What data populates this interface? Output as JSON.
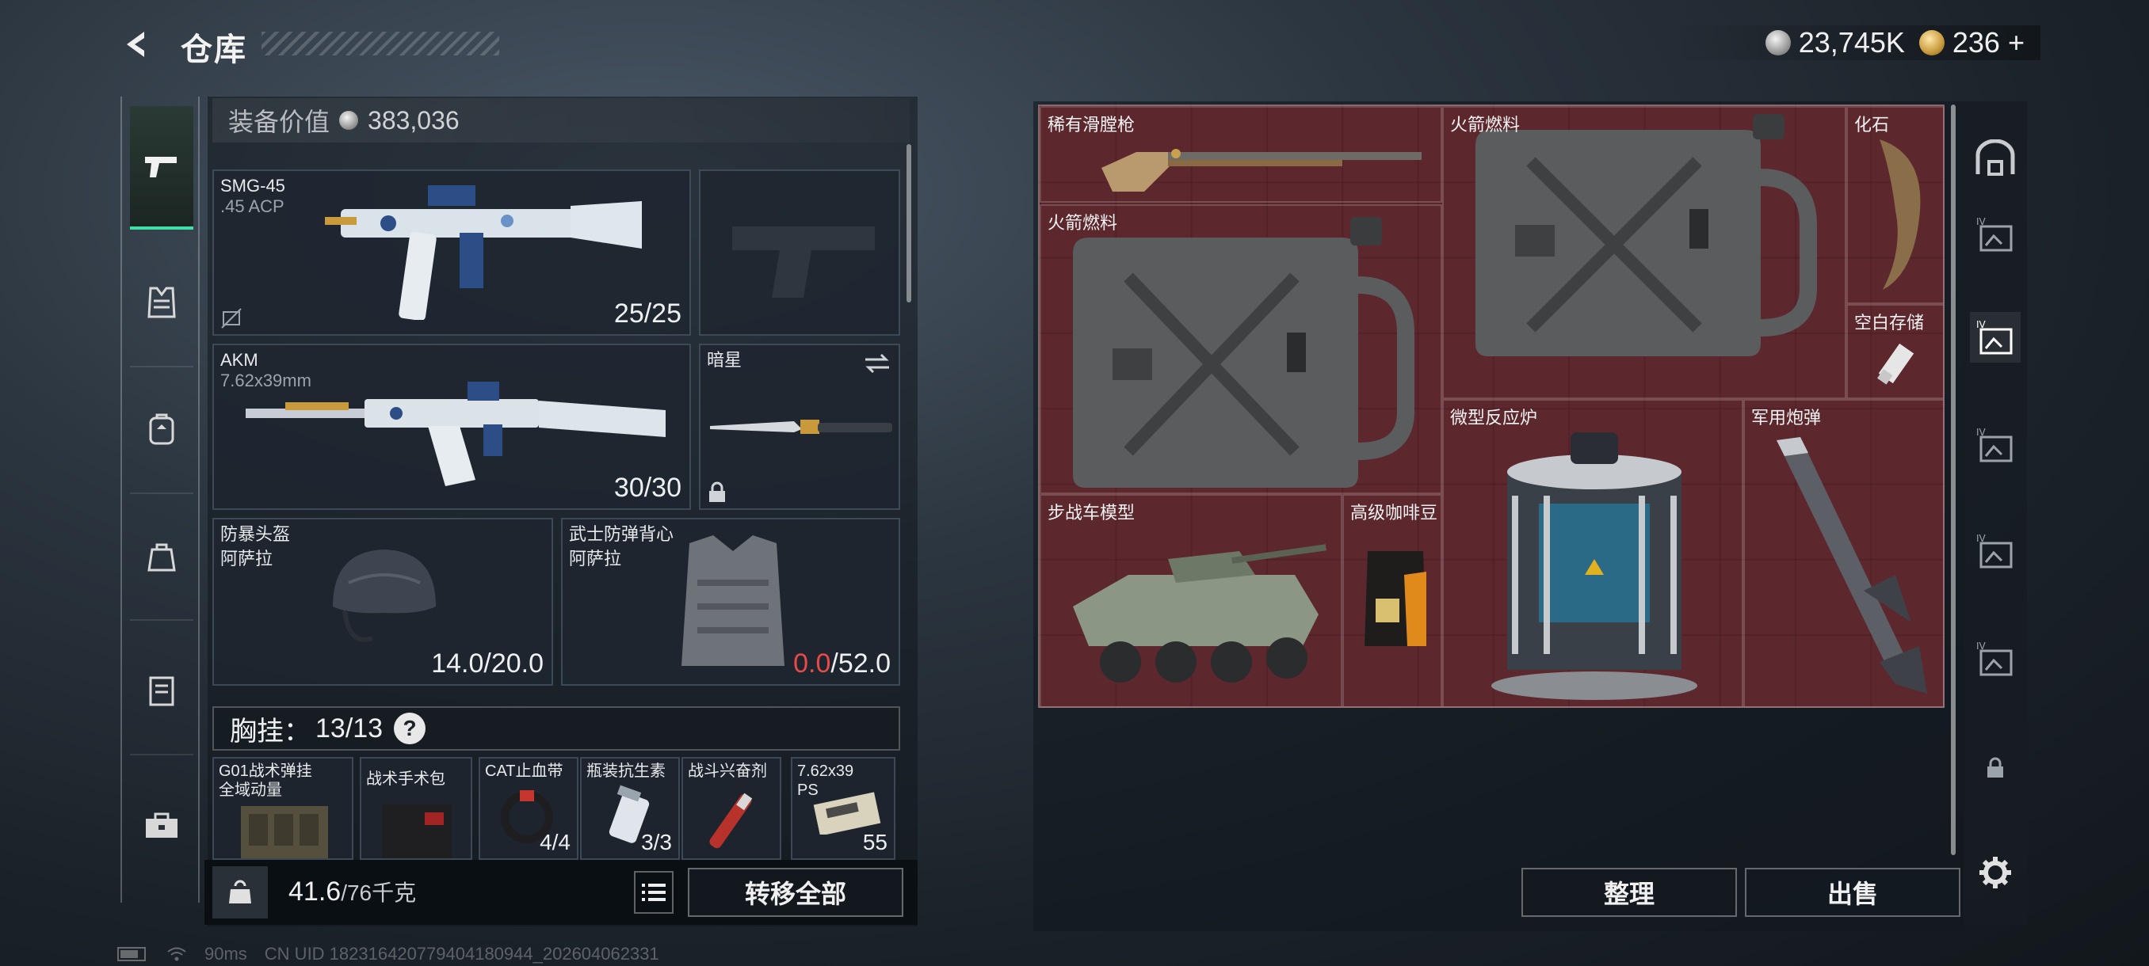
{
  "header": {
    "title": "仓库",
    "currency_silver": "23,745K",
    "currency_gold": "236",
    "add_symbol": "+"
  },
  "equipment": {
    "value_label": "装备价值",
    "value": "383,036",
    "primary1": {
      "name": "SMG-45",
      "ammo": ".45 ACP",
      "count": "25/25"
    },
    "primary2": {
      "name": "AKM",
      "ammo": "7.62x39mm",
      "count": "30/30"
    },
    "melee": {
      "name": "暗星"
    },
    "helmet": {
      "name": "防暴头盔",
      "sub": "阿萨拉",
      "durability": "14.0/20.0"
    },
    "armor": {
      "name": "武士防弹背心",
      "sub": "阿萨拉",
      "durability_cur": "0.0",
      "durability_max": "/52.0"
    },
    "chest": {
      "label": "胸挂：",
      "count": "13/13",
      "help": "?"
    },
    "chest_items": [
      {
        "name": "G01战术弹挂",
        "sub": "全域动量"
      },
      {
        "name": "战术手术包"
      },
      {
        "name": "CAT止血带",
        "count": "4/4"
      },
      {
        "name": "瓶装抗生素",
        "count": "3/3"
      },
      {
        "name": "战斗兴奋剂"
      },
      {
        "name": "7.62x39",
        "sub": "PS",
        "count": "55"
      }
    ],
    "weight": "41.6",
    "weight_max": "/76千克",
    "transfer_all": "转移全部"
  },
  "storage": {
    "items": [
      {
        "name": "稀有滑膛枪"
      },
      {
        "name": "火箭燃料"
      },
      {
        "name": "火箭燃料"
      },
      {
        "name": "化石"
      },
      {
        "name": "空白存储"
      },
      {
        "name": "微型反应炉"
      },
      {
        "name": "军用炮弹"
      },
      {
        "name": "步战车模型"
      },
      {
        "name": "高级咖啡豆"
      }
    ],
    "sort": "整理",
    "sell": "出售"
  },
  "status": {
    "ping": "90ms",
    "uid": "CN UID 182316420779404180944_202604062331"
  },
  "colors": {
    "accent": "#3fe0a8",
    "storage_bg": "#54272c",
    "warning": "#e84a4a"
  }
}
